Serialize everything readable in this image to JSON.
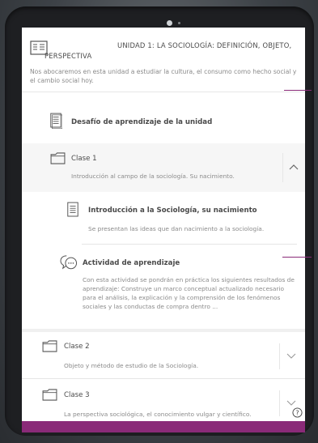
{
  "unit": {
    "title_line1": "UNIDAD 1: LA SOCIOLOGÍA: DEFINICIÓN, OBJETO,",
    "title_line2": "PERSPECTIVA",
    "description": "Nos abocaremos en esta unidad a estudiar la cultura, el consumo como hecho social y el cambio social hoy."
  },
  "challenge": {
    "label": "Desafío de aprendizaje de la unidad"
  },
  "classes": [
    {
      "label": "Clase 1",
      "subtitle": "Introducción al campo de la sociología. Su nacimiento."
    },
    {
      "label": "Clase 2",
      "subtitle": "Objeto y método de estudio de la Sociología."
    },
    {
      "label": "Clase 3",
      "subtitle": "La perspectiva sociológica, el conocimiento vulgar y científico."
    }
  ],
  "lesson": {
    "title": "Introducción a la Sociología, su nacimiento",
    "subtitle": "Se presentan las ideas que dan nacimiento a la sociología."
  },
  "activity": {
    "title": "Actividad de aprendizaje",
    "description": "Con esta actividad se pondrán en práctica los siguientes resultados de aprendizaje: Construye un marco conceptual actualizado necesario para el análisis, la explicación y la comprensión de los fenómenos sociales y las conductas de compra dentro ..."
  },
  "colors": {
    "accent": "#8a2a78",
    "text": "#4a4a4a",
    "muted": "#8a8a8a",
    "band": "#f6f6f6"
  },
  "icons": [
    "book-icon",
    "document-icon",
    "folder-icon",
    "chevron-up-icon",
    "chevron-down-icon",
    "chat-bubble-icon",
    "help-icon"
  ]
}
